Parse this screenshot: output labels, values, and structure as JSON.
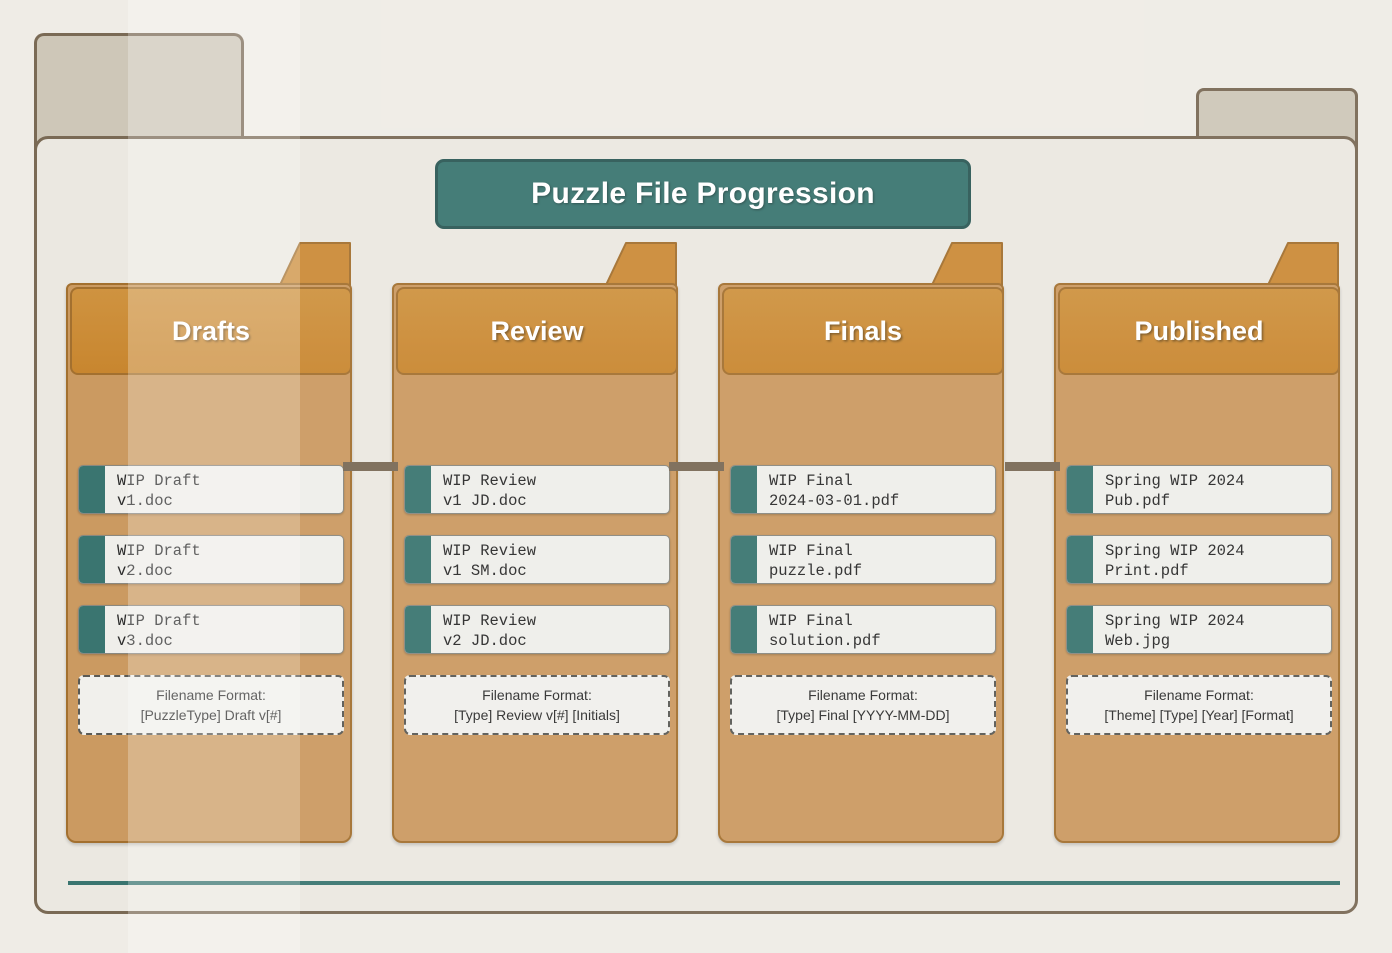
{
  "title": "Puzzle File Progression",
  "theme": {
    "teal": "#3a7570",
    "folder_header_orange": "#c8862f",
    "folder_body_orange": "#cb9a61",
    "outer_border_brown": "#7a6a55",
    "outer_tab_beige": "#cec7b8",
    "canvas_beige": "#efece6",
    "card_white": "#efeeea"
  },
  "format_label": "Filename Format:",
  "columns": [
    {
      "name": "Drafts",
      "files": [
        {
          "line1": "WIP Draft",
          "line2": "v1.doc"
        },
        {
          "line1": "WIP Draft",
          "line2": "v2.doc"
        },
        {
          "line1": "WIP Draft",
          "line2": "v3.doc"
        }
      ],
      "format_pattern": "[PuzzleType] Draft v[#]"
    },
    {
      "name": "Review",
      "files": [
        {
          "line1": "WIP Review",
          "line2": "v1 JD.doc"
        },
        {
          "line1": "WIP Review",
          "line2": "v1 SM.doc"
        },
        {
          "line1": "WIP Review",
          "line2": "v2 JD.doc"
        }
      ],
      "format_pattern": "[Type] Review v[#] [Initials]"
    },
    {
      "name": "Finals",
      "files": [
        {
          "line1": "WIP Final",
          "line2": "2024-03-01.pdf"
        },
        {
          "line1": "WIP Final",
          "line2": "puzzle.pdf"
        },
        {
          "line1": "WIP Final",
          "line2": "solution.pdf"
        }
      ],
      "format_pattern": "[Type] Final [YYYY-MM-DD]"
    },
    {
      "name": "Published",
      "files": [
        {
          "line1": "Spring WIP 2024",
          "line2": "Pub.pdf"
        },
        {
          "line1": "Spring WIP 2024",
          "line2": "Print.pdf"
        },
        {
          "line1": "Spring WIP 2024",
          "line2": "Web.jpg"
        }
      ],
      "format_pattern": "[Theme] [Type] [Year] [Format]"
    }
  ]
}
